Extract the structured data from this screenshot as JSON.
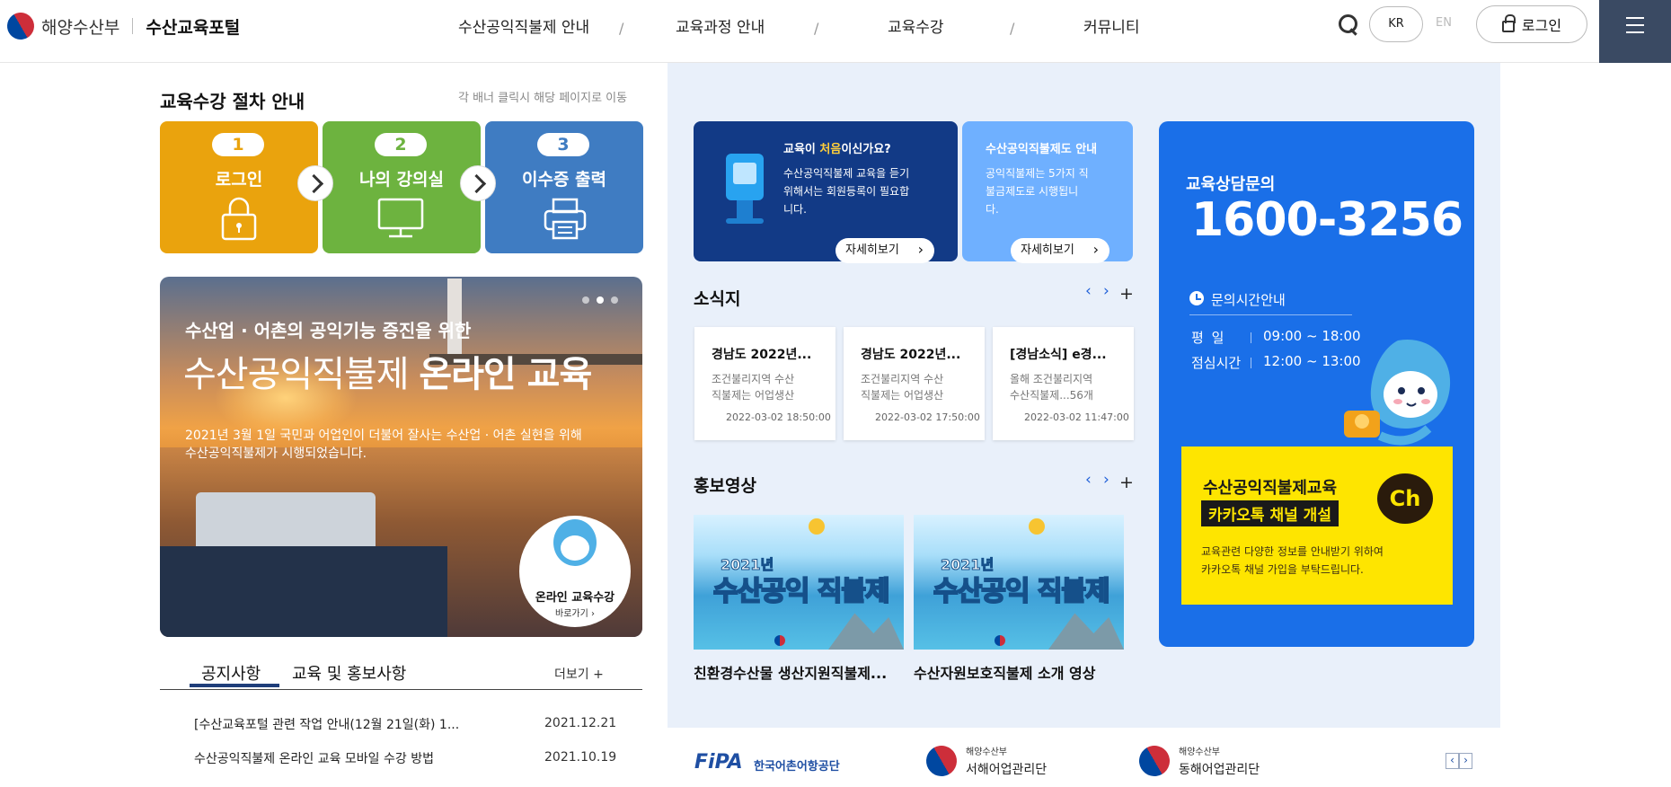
{
  "header": {
    "ministry": "해양수산부",
    "portal": "수산교육포털",
    "nav": [
      "수산공익직불제 안내",
      "교육과정 안내",
      "교육수강",
      "커뮤니티"
    ],
    "nav_sep": "/",
    "lang_kr": "KR",
    "lang_en": "EN",
    "login": "로그인"
  },
  "steps": {
    "title": "교육수강 절차 안내",
    "hint": "각 배너 클릭시 해당 페이지로 이동",
    "items": [
      {
        "num": "1",
        "label": "로그인",
        "color": "#eaa30d",
        "icon": "lock-icon"
      },
      {
        "num": "2",
        "label": "나의 강의실",
        "color": "#6db33f",
        "icon": "monitor-icon"
      },
      {
        "num": "3",
        "label": "이수증 출력",
        "color": "#3f7cc2",
        "icon": "printer-icon"
      }
    ]
  },
  "banner": {
    "sub": "수산업 · 어촌의 공익기능 증진을 위한",
    "main_a": "수산공익직불제 ",
    "main_b": "온라인 교육",
    "desc1": "2021년 3월 1일 국민과 어업인이 더불어 잘사는 수산업 · 어촌 실현을 위해",
    "desc2": "수산공익직불제가 시행되었습니다.",
    "circle_title": "온라인 교육수강",
    "circle_link": "바로가기 ›"
  },
  "notice": {
    "tabs": [
      "공지사항",
      "교육 및 홍보사항"
    ],
    "more": "더보기  +",
    "items": [
      {
        "title": "[수산교육포털 관련 작업 안내(12월 21일(화) 1...",
        "date": "2021.12.21"
      },
      {
        "title": "수산공익직불제 온라인 교육 모바일 수강 방법",
        "date": "2021.10.19"
      }
    ]
  },
  "info": {
    "first": {
      "title_a": "교육이 ",
      "title_b": "처음",
      "title_c": "이신가요?",
      "lines": [
        "수산공익직불제 교육을 듣기",
        "위해서는 회원등록이 필요합",
        "니다."
      ],
      "button": "자세히보기"
    },
    "system": {
      "title": "수산공익직불제도 안내",
      "lines": [
        "공익직불제는 5가지 직",
        "불금제도로 시행됩니",
        "다."
      ],
      "button": "자세히보기"
    }
  },
  "news": {
    "title": "소식지",
    "prev": "‹",
    "next": "›",
    "plus": "+",
    "items": [
      {
        "title": "경남도 2022년...",
        "body1": "조건불리지역 수산",
        "body2": "직불제는 어업생산",
        "date": "2022-03-02 18:50:00"
      },
      {
        "title": "경남도 2022년...",
        "body1": "조건불리지역 수산",
        "body2": "직불제는 어업생산",
        "date": "2022-03-02 17:50:00"
      },
      {
        "title": "[경남소식] e경...",
        "body1": "올해 조건불리지역",
        "body2": "수산직불제...56개",
        "date": "2022-03-02 11:47:00"
      }
    ]
  },
  "videos": {
    "title": "홍보영상",
    "prev": "‹",
    "next": "›",
    "plus": "+",
    "thumb_year": "2021년",
    "thumb_title": "수산공익 직불제",
    "items": [
      {
        "caption": "친환경수산물 생산지원직불제..."
      },
      {
        "caption": "수산자원보호직불제 소개 영상"
      }
    ]
  },
  "consult": {
    "label": "교육상담문의",
    "phone": "1600-3256",
    "hours_title": "문의시간안내",
    "rows": [
      {
        "label": "평  일",
        "value": "09:00 ~ 18:00"
      },
      {
        "label": "점심시간",
        "value": "12:00 ~ 13:00"
      }
    ],
    "kakao": {
      "line1": "수산공익직불제교육",
      "line2": "카카오톡 채널 개설",
      "ch": "Ch",
      "line3": "교육관련 다양한 정보를 안내받기 위하여",
      "line4": "카카오톡 채널 가입을 부탁드립니다."
    }
  },
  "partners": {
    "fipa": "FiPA",
    "fipa_name": "한국어촌어항공단",
    "p2_small": "해양수산부",
    "p2_name": "서해어업관리단",
    "p3_small": "해양수산부",
    "p3_name": "동해어업관리단",
    "prev": "‹",
    "next": "›"
  },
  "colors": {
    "nav_dark": "#3a4a63",
    "mid_bg": "#e9f0fa",
    "info_dark": "#123a86",
    "info_light": "#6fb0ff",
    "consult_blue": "#1a6fe8",
    "kakao_yellow": "#fee500"
  }
}
